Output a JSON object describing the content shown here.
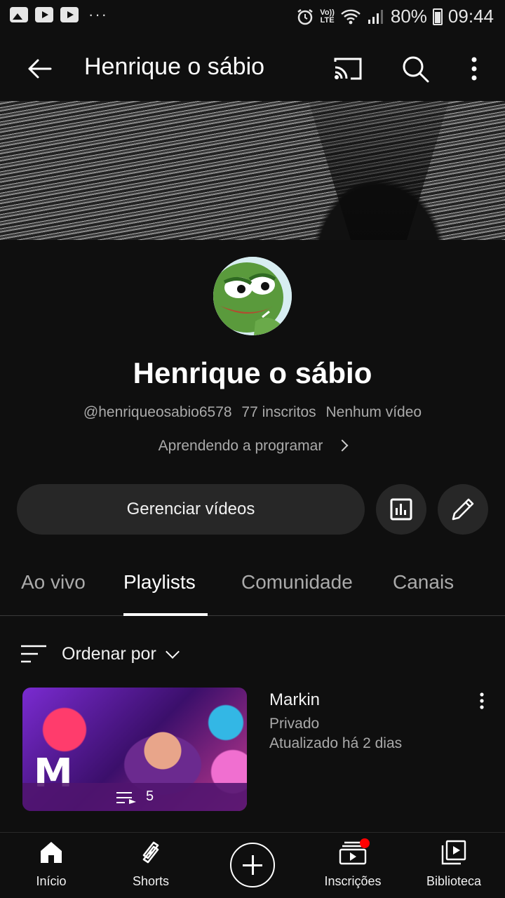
{
  "status_bar": {
    "battery": "80%",
    "time": "09:44",
    "network_label_top": "Vo))",
    "network_label_bottom": "LTE",
    "icons": [
      "image-icon",
      "youtube-icon",
      "youtube-icon",
      "more-dots-icon",
      "alarm-icon",
      "volte-icon",
      "wifi-icon",
      "signal-icon",
      "battery-icon"
    ]
  },
  "appbar": {
    "title": "Henrique o sábio",
    "icons": [
      "back-arrow-icon",
      "cast-icon",
      "search-icon",
      "more-vert-icon"
    ]
  },
  "channel": {
    "name": "Henrique o sábio",
    "handle": "@henriqueosabio6578",
    "subscribers": "77 inscritos",
    "videos": "Nenhum vídeo",
    "description": "Aprendendo a programar"
  },
  "actions": {
    "manage_label": "Gerenciar vídeos",
    "icons": [
      "analytics-icon",
      "edit-pencil-icon"
    ]
  },
  "tabs": [
    {
      "label": "Ao vivo",
      "active": false
    },
    {
      "label": "Playlists",
      "active": true
    },
    {
      "label": "Comunidade",
      "active": false
    },
    {
      "label": "Canais",
      "active": false
    }
  ],
  "sort": {
    "label": "Ordenar por"
  },
  "playlists": [
    {
      "title": "Markin",
      "privacy": "Privado",
      "updated": "Atualizado há 2 dias",
      "count": "5"
    }
  ],
  "bottom_nav": [
    {
      "label": "Início",
      "icon": "home-icon"
    },
    {
      "label": "Shorts",
      "icon": "shorts-icon"
    },
    {
      "label": "",
      "icon": "create-plus-icon"
    },
    {
      "label": "Inscrições",
      "icon": "subscriptions-icon"
    },
    {
      "label": "Biblioteca",
      "icon": "library-icon"
    }
  ],
  "colors": {
    "background": "#0f0f0f",
    "surface": "#272727",
    "text_secondary": "#aaaaaa",
    "notification": "#ff0000"
  }
}
